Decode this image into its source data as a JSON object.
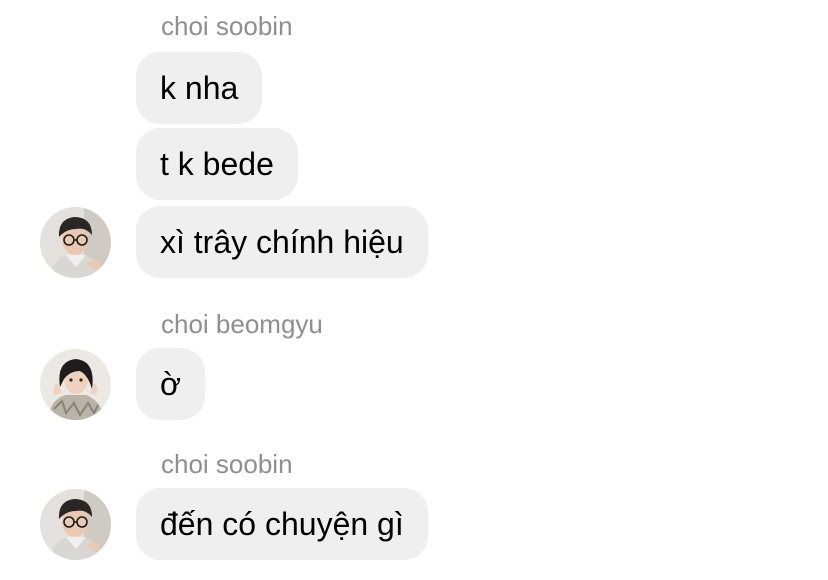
{
  "groups": [
    {
      "sender": "choi soobin",
      "avatar_icon": "profile-photo-soobin",
      "messages": [
        "k nha",
        "t k bede",
        "xì trây chính hiệu"
      ]
    },
    {
      "sender": "choi beomgyu",
      "avatar_icon": "profile-photo-beomgyu",
      "messages": [
        "ờ"
      ]
    },
    {
      "sender": "choi soobin",
      "avatar_icon": "profile-photo-soobin",
      "messages": [
        "đến có chuyện gì"
      ]
    }
  ],
  "colors": {
    "bubble": "#efefef",
    "sender_name": "#8e8e93",
    "message_text": "#000000"
  }
}
